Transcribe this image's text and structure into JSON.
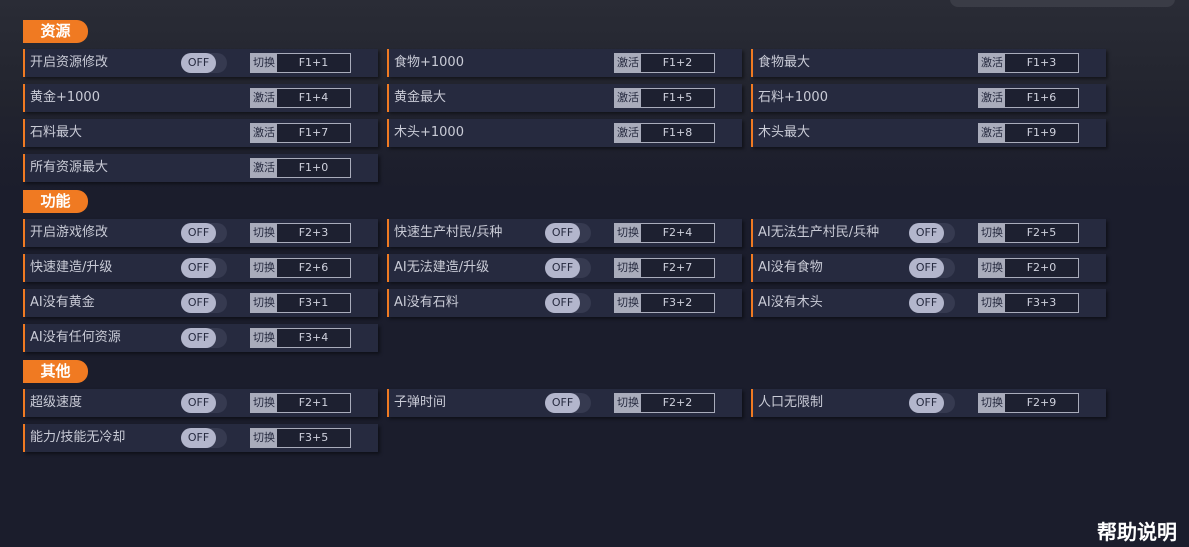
{
  "colors": {
    "accent": "#f07a22",
    "row_bg": "#262a3f",
    "page_bg": "#1b1d2c"
  },
  "sections": [
    {
      "title": "资源",
      "items": [
        {
          "label": "开启资源修改",
          "toggle": "OFF",
          "action": "切换",
          "hotkey": "F1+1"
        },
        {
          "label": "食物+1000",
          "action": "激活",
          "hotkey": "F1+2"
        },
        {
          "label": "食物最大",
          "action": "激活",
          "hotkey": "F1+3"
        },
        {
          "label": "黄金+1000",
          "action": "激活",
          "hotkey": "F1+4"
        },
        {
          "label": "黄金最大",
          "action": "激活",
          "hotkey": "F1+5"
        },
        {
          "label": "石料+1000",
          "action": "激活",
          "hotkey": "F1+6"
        },
        {
          "label": "石料最大",
          "action": "激活",
          "hotkey": "F1+7"
        },
        {
          "label": "木头+1000",
          "action": "激活",
          "hotkey": "F1+8"
        },
        {
          "label": "木头最大",
          "action": "激活",
          "hotkey": "F1+9"
        },
        {
          "label": "所有资源最大",
          "action": "激活",
          "hotkey": "F1+0"
        }
      ]
    },
    {
      "title": "功能",
      "items": [
        {
          "label": "开启游戏修改",
          "toggle": "OFF",
          "action": "切换",
          "hotkey": "F2+3"
        },
        {
          "label": "快速生产村民/兵种",
          "toggle": "OFF",
          "action": "切换",
          "hotkey": "F2+4"
        },
        {
          "label": "AI无法生产村民/兵种",
          "toggle": "OFF",
          "action": "切换",
          "hotkey": "F2+5"
        },
        {
          "label": "快速建造/升级",
          "toggle": "OFF",
          "action": "切换",
          "hotkey": "F2+6"
        },
        {
          "label": "AI无法建造/升级",
          "toggle": "OFF",
          "action": "切换",
          "hotkey": "F2+7"
        },
        {
          "label": "AI没有食物",
          "toggle": "OFF",
          "action": "切换",
          "hotkey": "F2+0"
        },
        {
          "label": "AI没有黄金",
          "toggle": "OFF",
          "action": "切换",
          "hotkey": "F3+1"
        },
        {
          "label": "AI没有石料",
          "toggle": "OFF",
          "action": "切换",
          "hotkey": "F3+2"
        },
        {
          "label": "AI没有木头",
          "toggle": "OFF",
          "action": "切换",
          "hotkey": "F3+3"
        },
        {
          "label": "AI没有任何资源",
          "toggle": "OFF",
          "action": "切换",
          "hotkey": "F3+4"
        }
      ]
    },
    {
      "title": "其他",
      "items": [
        {
          "label": "超级速度",
          "toggle": "OFF",
          "action": "切换",
          "hotkey": "F2+1"
        },
        {
          "label": "子弹时间",
          "toggle": "OFF",
          "action": "切换",
          "hotkey": "F2+2"
        },
        {
          "label": "人口无限制",
          "toggle": "OFF",
          "action": "切换",
          "hotkey": "F2+9"
        },
        {
          "label": "能力/技能无冷却",
          "toggle": "OFF",
          "action": "切换",
          "hotkey": "F3+5"
        }
      ]
    }
  ],
  "help": {
    "label": "帮助说明"
  }
}
